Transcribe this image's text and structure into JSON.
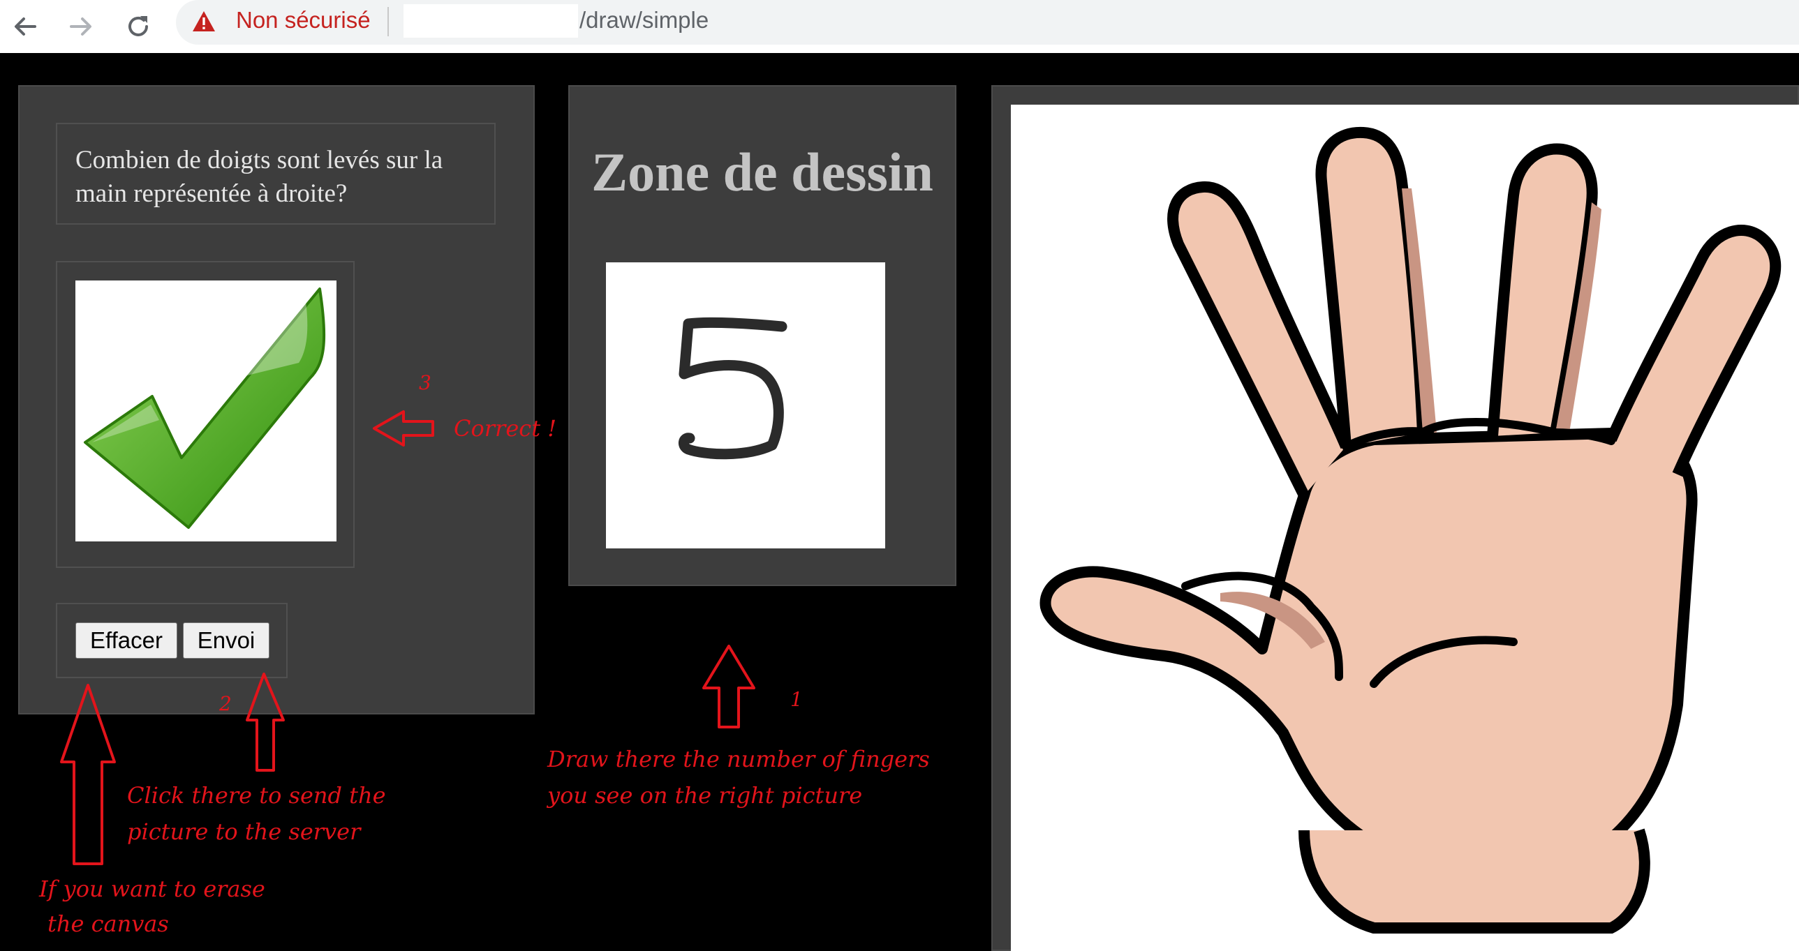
{
  "browser": {
    "security_status": "Non sécurisé",
    "url_path": "/draw/simple",
    "icons": [
      "back-arrow-icon",
      "forward-arrow-icon",
      "reload-icon",
      "warning-icon"
    ]
  },
  "question_panel": {
    "question": "Combien de doigts sont levés sur la main représentée à droite?",
    "result_icon": "green-checkmark-icon",
    "buttons": {
      "erase": "Effacer",
      "send": "Envoi"
    }
  },
  "drawing_panel": {
    "title": "Zone de dessin",
    "drawn_digit": "5"
  },
  "reference_image": {
    "description_icon": "open-hand-five-fingers"
  },
  "annotations": {
    "step1_number": "1",
    "step1_text": [
      "Draw there the number of fingers",
      "you see on the right picture"
    ],
    "step2_number": "2",
    "step2_text": [
      "Click there to send the",
      "picture to the server"
    ],
    "erase_text": [
      "If you want to erase",
      "the canvas"
    ],
    "step3_number": "3",
    "step3_text": "Correct !"
  },
  "colors": {
    "annotation": "#e3141b",
    "panel": "#3d3d3d",
    "background": "#000000",
    "warning": "#c5221f"
  }
}
